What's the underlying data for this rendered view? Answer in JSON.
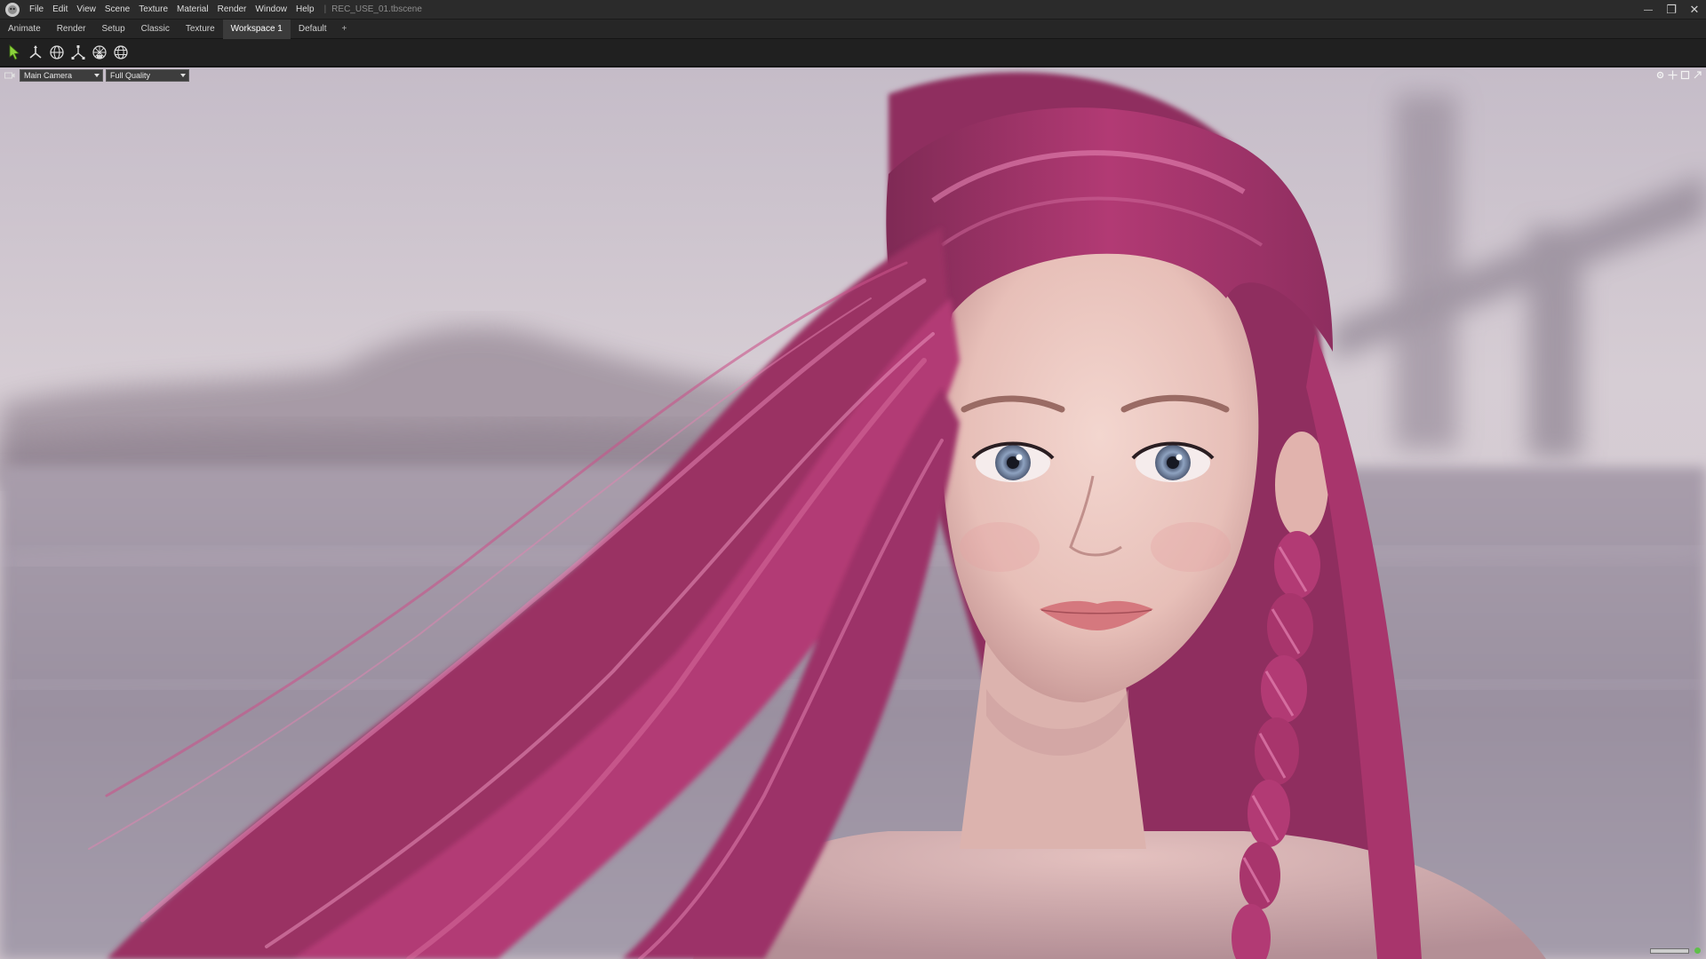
{
  "window": {
    "file_name": "REC_USE_01.tbscene",
    "separator": "|",
    "controls": {
      "minimize": "—",
      "maximize": "❐",
      "close": "✕"
    }
  },
  "menu": {
    "items": [
      {
        "label": "File"
      },
      {
        "label": "Edit"
      },
      {
        "label": "View"
      },
      {
        "label": "Scene"
      },
      {
        "label": "Texture"
      },
      {
        "label": "Material"
      },
      {
        "label": "Render"
      },
      {
        "label": "Window"
      },
      {
        "label": "Help"
      }
    ]
  },
  "workspace_tabs": {
    "items": [
      {
        "label": "Animate"
      },
      {
        "label": "Render"
      },
      {
        "label": "Setup"
      },
      {
        "label": "Classic"
      },
      {
        "label": "Texture"
      },
      {
        "label": "Workspace 1",
        "active": true
      },
      {
        "label": "Default"
      }
    ],
    "add_label": "+"
  },
  "toolbar": {
    "tools": [
      {
        "icon": "select-arrow-icon",
        "color": "#8bd23b"
      },
      {
        "icon": "move-gizmo-icon",
        "color": "#d8d8d8"
      },
      {
        "icon": "rotate-gizmo-icon",
        "color": "#d8d8d8"
      },
      {
        "icon": "scale-gizmo-icon",
        "color": "#d8d8d8"
      },
      {
        "icon": "skeleton-mesh-icon",
        "color": "#d8d8d8"
      },
      {
        "icon": "world-grid-icon",
        "color": "#d8d8d8"
      }
    ]
  },
  "viewport": {
    "camera": {
      "selected": "Main Camera"
    },
    "quality": {
      "selected": "Full Quality"
    },
    "header_icons": [
      "settings-icon",
      "move-icon",
      "maximize-icon",
      "popout-icon"
    ],
    "status_color": "#5fbf4a"
  },
  "colors": {
    "hair": "#b23a74",
    "hair_highlight": "#e483b2",
    "skin": "#e9c3bd",
    "sky": "#d3cad2",
    "water": "#9f95a5"
  }
}
